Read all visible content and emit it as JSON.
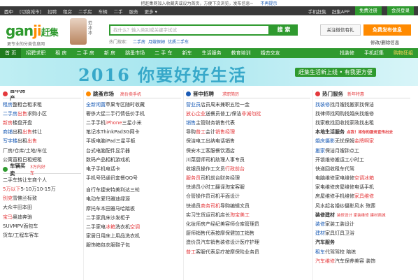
{
  "notice": {
    "text": "把赶集网加入收藏夹或设为首页，方便下次浏览，发布信息~",
    "close": "不再提示"
  },
  "topbar": {
    "left": [
      "西中",
      "[切换城市]",
      "招聘",
      "租房",
      "二手房",
      "车辆",
      "二手",
      "服务",
      "更多 ▾"
    ],
    "right": [
      "手机赶集",
      "赶集APP",
      "免费注册",
      "会员登录"
    ]
  },
  "header": {
    "logo_main": "gan",
    "logo_accent": "ji",
    "logo_cn": "赶集",
    "slogan": "更专业的分类信息网",
    "avatar_name": "范冰冰",
    "search_placeholder": "找什么？输入类别或关键字试试",
    "search_button": "搜 索",
    "hot_label": "热门搜索：",
    "hot_links": [
      "二手房",
      "月嫂保姆",
      "优质二手车"
    ],
    "wechat": "关注微信有礼",
    "post_button": "免费发布信息",
    "modify": "修改/删除信息"
  },
  "nav": {
    "items": [
      "首 页",
      "招聘求职",
      "租 房",
      "二 手 房",
      "新 房",
      "跳蚤市场",
      "二 手 车",
      "新车",
      "生活服务",
      "教育培训",
      "婚恋交友"
    ],
    "right_items": [
      "找装修",
      "手机赶集",
      "购物狂组"
    ]
  },
  "banner": {
    "headline": "2016  你要好好生活",
    "tag": "赶集生活新上线 • 有我更方便"
  },
  "columns": {
    "house": {
      "title": "晋中房产",
      "rows": [
        [
          "租房",
          "整租",
          "合租",
          "求租"
        ],
        [
          "二手房",
          "出售",
          "求购",
          "小区"
        ],
        [
          "新房",
          "楼盘",
          "开盘"
        ],
        [
          "商铺",
          "出租",
          "出售",
          "转让"
        ],
        [
          "写字楼",
          "出租",
          "出售"
        ],
        [
          "厂房/仓库/土地/车位"
        ],
        [
          "公寓直租",
          "日租短租"
        ]
      ],
      "car_title": "车辆买卖",
      "car_sub": "3万内好车",
      "car_rows": [
        [
          "二手车转让",
          "车商",
          "个人"
        ],
        [
          "5万以下",
          "5-10万",
          "10-15万"
        ],
        [
          "别克",
          "雪佛兰",
          "标致"
        ],
        [
          "大众",
          "丰田",
          "本田"
        ],
        [
          "宝马",
          "奥迪",
          "奔驰"
        ],
        [
          "SUV",
          "MPV",
          "面包车"
        ],
        [
          "货车/工程车",
          "客车"
        ]
      ]
    },
    "flea": {
      "title": "跳蚤市场",
      "sub": "高价卖手机",
      "rows": [
        [
          "全新闲置",
          "苹果专区",
          "随时收藏"
        ],
        [
          "奢侈大促",
          "二手行情",
          "低价手机"
        ],
        [
          "二手手机",
          "iPhone",
          "三星",
          "小米"
        ],
        [
          "笔记本",
          "ThinkPad",
          "3G网卡"
        ],
        [
          "平板电脑",
          "iPad",
          "三星平板"
        ],
        [
          "台式电脑",
          "配件",
          "显示器"
        ],
        [
          "数码产品",
          "相机",
          "游戏机"
        ],
        [
          "电子手机",
          "电话卡"
        ],
        [
          "手机号码",
          "通讯套餐",
          "QQ号"
        ]
      ],
      "rows2": [
        [
          "自行车",
          "捷安特",
          "美利达",
          "三轮"
        ],
        [
          "电动车",
          "爱玛",
          "雅迪",
          "绿源"
        ],
        [
          "摩托车",
          "本田",
          "雅马哈",
          "踏板"
        ],
        [
          "二手家具",
          "床",
          "沙发",
          "柜子"
        ],
        [
          "二手家电",
          "冰箱",
          "洗衣机",
          "空调"
        ],
        [
          "家居日用",
          "床上用品",
          "洗衣机"
        ],
        [
          "服饰箱包",
          "衣服",
          "鞋子",
          "包"
        ]
      ]
    },
    "jobs": {
      "title": "晋中招聘",
      "sub": "求职简历",
      "rows": [
        [
          "营业员",
          "店员",
          "周末兼职",
          "五险一金"
        ],
        [
          "放心企业",
          "送餐员",
          "普工/保洁",
          "非诚勿扰"
        ],
        [
          "销售",
          "主管",
          "财务",
          "销售代表"
        ],
        [
          "导购",
          "普工",
          "会计",
          "销售经理"
        ],
        [
          "保洁",
          "电工",
          "出纳",
          "电话销售"
        ],
        [
          "保安",
          "木工",
          "客服",
          "餐饮酒店"
        ],
        [
          "川菜厨师",
          "司机",
          "助理",
          "人事专员"
        ],
        [
          "收银员",
          "操作工",
          "文员",
          "行政前台"
        ],
        [
          "服务员",
          "司机",
          "前台",
          "财务经理"
        ],
        [
          "快递员",
          "小时工",
          "翻译",
          "淘宝客服"
        ],
        [
          "仓管",
          "操作员",
          "司机",
          "平面设计"
        ],
        [
          "快递员",
          "商务司机",
          "导购",
          "编辑文员"
        ],
        [
          "实习生",
          "货运司机",
          "店长",
          "淘宝美工"
        ],
        [
          "化妆师",
          "房产经纪",
          "美容师",
          "仓库管理员"
        ],
        [
          "厨师",
          "销售代表",
          "按摩保健",
          "加工销售"
        ],
        [
          "造价员",
          "汽车销售",
          "装修设计",
          "医疗护理"
        ],
        [
          "普工",
          "客服代表",
          "足疗按摩",
          "保险业务员"
        ]
      ]
    },
    "services": {
      "title": "热门服务",
      "sub": "新年特惠",
      "rows": [
        [
          "找装修",
          "找月嫂",
          "找搬家",
          "找保洁"
        ],
        [
          "找律师",
          "找网购",
          "找婚庆",
          "找维修"
        ],
        [
          "找家教",
          "找回收",
          "找家政",
          "找出租"
        ]
      ],
      "life_title": "本地生活服务",
      "life_sub": "点我！将你的服务宣传出去",
      "life_rows": [
        [
          "婚庆摄影",
          "无忧保姆",
          "金牌啊家"
        ],
        [
          "搬家",
          "保洁",
          "月嫂",
          "钟点工"
        ],
        [
          "开锁",
          "维修",
          "搬运工",
          "小时工"
        ],
        [
          "快递",
          "回收",
          "租车",
          "代驾"
        ],
        [
          "电脑维修",
          "家电维修",
          "空调",
          "冰箱"
        ],
        [
          "家电维修",
          "房屋维修",
          "电话",
          "手机"
        ],
        [
          "房屋维修",
          "手机维修",
          "家具维修"
        ],
        [
          "风水",
          "起名",
          "婚纱摄影",
          "风水 殡葬"
        ]
      ],
      "deco_title": "装修建材",
      "deco_sub": "装修设计 家装维修 建材商城",
      "deco_rows": [
        [
          "装修",
          "家装",
          "工装",
          "设计"
        ],
        [
          "建材",
          "家具",
          "灯具",
          "卫浴"
        ]
      ],
      "car_title": "汽车服务",
      "car_rows": [
        [
          "租车",
          "代驾",
          "驾校 陪练"
        ],
        [
          "汽车维修",
          "汽车保养",
          "美容 装饰"
        ]
      ]
    }
  },
  "colors": {
    "brand_green": "#2f9a2f",
    "accent_orange": "#ff8a00",
    "link_blue": "#1a5bb5",
    "hot_red": "#e4393c"
  }
}
